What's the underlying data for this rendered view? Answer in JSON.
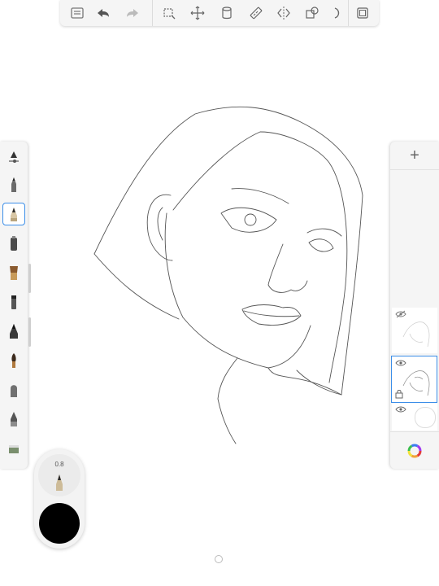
{
  "top_toolbar": {
    "items": [
      {
        "icon": "gallery-icon"
      },
      {
        "icon": "undo-icon"
      },
      {
        "icon": "redo-icon"
      },
      {
        "icon": "selection-icon"
      },
      {
        "icon": "transform-icon"
      },
      {
        "icon": "layers-stack-icon"
      },
      {
        "icon": "ruler-icon"
      },
      {
        "icon": "symmetry-icon"
      },
      {
        "icon": "shapes-icon"
      },
      {
        "icon": "curve-icon"
      },
      {
        "icon": "fullscreen-icon"
      }
    ]
  },
  "left_toolbar": {
    "brushes": [
      {
        "icon": "brush-settings-icon"
      },
      {
        "icon": "pencil-brush-icon"
      },
      {
        "icon": "marker-brush-icon",
        "selected": true
      },
      {
        "icon": "airbrush-icon"
      },
      {
        "icon": "paintbrush-icon"
      },
      {
        "icon": "chisel-marker-icon"
      },
      {
        "icon": "ink-pen-icon"
      },
      {
        "icon": "round-brush-icon"
      },
      {
        "icon": "blender-brush-icon"
      },
      {
        "icon": "fill-brush-icon"
      },
      {
        "icon": "texture-brush-icon"
      }
    ]
  },
  "puck": {
    "size_value": "0.8",
    "color": "#000000"
  },
  "layers": {
    "add_label": "+",
    "items": [
      {
        "icon": "eye-hidden-icon",
        "active": false
      },
      {
        "icon": "eye-icon",
        "active": true
      },
      {
        "icon": "eye-icon",
        "active": false
      }
    ]
  },
  "colors": {
    "accent": "#3b8ee8",
    "panel": "#f5f5f5"
  }
}
